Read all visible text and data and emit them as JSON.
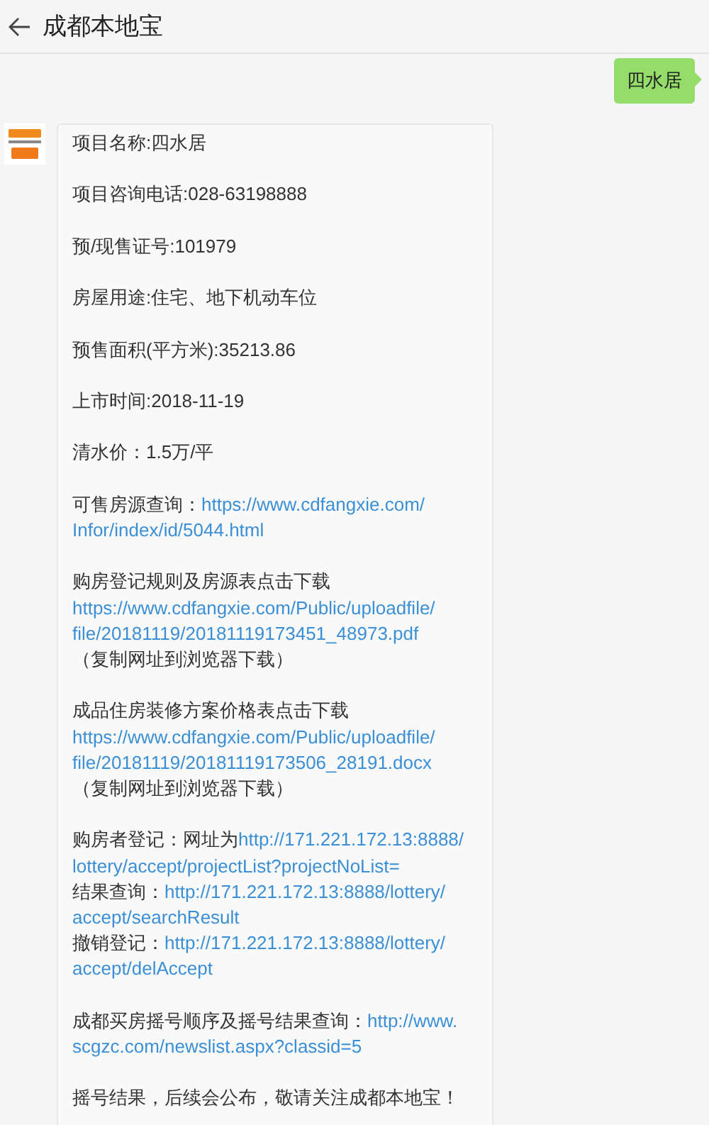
{
  "header": {
    "title": "成都本地宝"
  },
  "outgoing": {
    "text": "四水居"
  },
  "incoming": {
    "paragraphs": [
      [
        [
          {
            "kind": "text",
            "text": "项目名称:四水居"
          }
        ]
      ],
      [
        [
          {
            "kind": "text",
            "text": "项目咨询电话:028-63198888"
          }
        ]
      ],
      [
        [
          {
            "kind": "text",
            "text": "预/现售证号:101979"
          }
        ]
      ],
      [
        [
          {
            "kind": "text",
            "text": "房屋用途:住宅、地下机动车位"
          }
        ]
      ],
      [
        [
          {
            "kind": "text",
            "text": "预售面积(平方米):35213.86"
          }
        ]
      ],
      [
        [
          {
            "kind": "text",
            "text": "上市时间:2018-11-19"
          }
        ]
      ],
      [
        [
          {
            "kind": "text",
            "text": "清水价：1.5万/平"
          }
        ]
      ],
      [
        [
          {
            "kind": "text",
            "text": "可售房源查询："
          },
          {
            "kind": "link",
            "text": "https://www.cdfangxie.com/"
          }
        ],
        [
          {
            "kind": "link",
            "text": "Infor/index/id/5044.html"
          }
        ]
      ],
      [
        [
          {
            "kind": "text",
            "text": "购房登记规则及房源表点击下载"
          }
        ],
        [
          {
            "kind": "link",
            "text": "https://www.cdfangxie.com/Public/uploadfile/"
          }
        ],
        [
          {
            "kind": "link",
            "text": "file/20181119/20181119173451_48973.pdf"
          }
        ],
        [
          {
            "kind": "text",
            "text": "（复制网址到浏览器下载）"
          }
        ]
      ],
      [
        [
          {
            "kind": "text",
            "text": "成品住房装修方案价格表点击下载"
          }
        ],
        [
          {
            "kind": "link",
            "text": "https://www.cdfangxie.com/Public/uploadfile/"
          }
        ],
        [
          {
            "kind": "link",
            "text": "file/20181119/20181119173506_28191.docx"
          }
        ],
        [
          {
            "kind": "text",
            "text": "（复制网址到浏览器下载）"
          }
        ]
      ],
      [
        [
          {
            "kind": "text",
            "text": "购房者登记：网址为"
          },
          {
            "kind": "link",
            "text": "http://171.221.172.13:8888/"
          }
        ],
        [
          {
            "kind": "link",
            "text": "lottery/accept/projectList?projectNoList="
          }
        ],
        [
          {
            "kind": "text",
            "text": "结果查询："
          },
          {
            "kind": "link",
            "text": "http://171.221.172.13:8888/lottery/"
          }
        ],
        [
          {
            "kind": "link",
            "text": "accept/searchResult"
          }
        ],
        [
          {
            "kind": "text",
            "text": "撤销登记："
          },
          {
            "kind": "link",
            "text": "http://171.221.172.13:8888/lottery/"
          }
        ],
        [
          {
            "kind": "link",
            "text": "accept/delAccept"
          }
        ]
      ],
      [
        [
          {
            "kind": "text",
            "text": "成都买房摇号顺序及摇号结果查询："
          },
          {
            "kind": "link",
            "text": "http://www."
          }
        ],
        [
          {
            "kind": "link",
            "text": "scgzc.com/newslist.aspx?classid=5"
          }
        ]
      ],
      [
        [
          {
            "kind": "text",
            "text": "摇号结果，后续会公布，敬请关注成都本地宝！"
          }
        ]
      ]
    ]
  }
}
